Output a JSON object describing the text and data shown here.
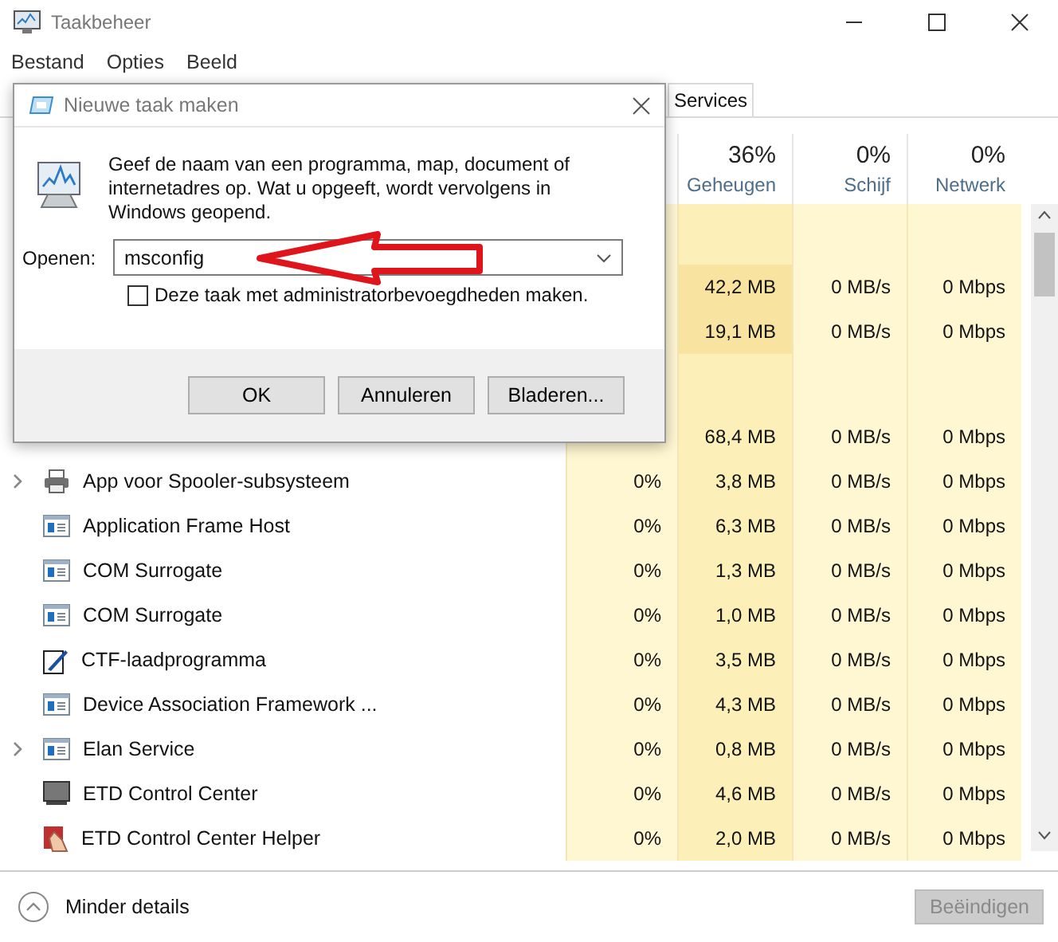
{
  "window": {
    "title": "Taakbeheer"
  },
  "menu": [
    "Bestand",
    "Opties",
    "Beeld"
  ],
  "tabs": [
    {
      "label": "Services",
      "selected": false
    }
  ],
  "columns": [
    {
      "value": "36%",
      "label": "Geheugen"
    },
    {
      "value": "0%",
      "label": "Schijf"
    },
    {
      "value": "0%",
      "label": "Netwerk"
    }
  ],
  "sections": [
    {
      "rows": [
        {
          "memory": "42,2 MB",
          "disk": "0 MB/s",
          "network": "0 Mbps"
        },
        {
          "memory": "19,1 MB",
          "disk": "0 MB/s",
          "network": "0 Mbps"
        }
      ]
    },
    {
      "rows": [
        {
          "memory": "68,4 MB",
          "disk": "0 MB/s",
          "network": "0 Mbps"
        },
        {
          "name": "App voor Spooler-subsysteem",
          "kind": "printer",
          "expandable": true,
          "cpu": "0%",
          "memory": "3,8 MB",
          "disk": "0 MB/s",
          "network": "0 Mbps"
        },
        {
          "name": "Application Frame Host",
          "kind": "app",
          "expandable": false,
          "cpu": "0%",
          "memory": "6,3 MB",
          "disk": "0 MB/s",
          "network": "0 Mbps"
        },
        {
          "name": "COM Surrogate",
          "kind": "app",
          "expandable": false,
          "cpu": "0%",
          "memory": "1,3 MB",
          "disk": "0 MB/s",
          "network": "0 Mbps"
        },
        {
          "name": "COM Surrogate",
          "kind": "app",
          "expandable": false,
          "cpu": "0%",
          "memory": "1,0 MB",
          "disk": "0 MB/s",
          "network": "0 Mbps"
        },
        {
          "name": "CTF-laadprogramma",
          "kind": "editor",
          "expandable": false,
          "cpu": "0%",
          "memory": "3,5 MB",
          "disk": "0 MB/s",
          "network": "0 Mbps"
        },
        {
          "name": "Device Association Framework ...",
          "kind": "app",
          "expandable": false,
          "cpu": "0%",
          "memory": "4,3 MB",
          "disk": "0 MB/s",
          "network": "0 Mbps"
        },
        {
          "name": "Elan Service",
          "kind": "app",
          "expandable": true,
          "cpu": "0%",
          "memory": "0,8 MB",
          "disk": "0 MB/s",
          "network": "0 Mbps"
        },
        {
          "name": "ETD Control Center",
          "kind": "monitor",
          "expandable": false,
          "cpu": "0%",
          "memory": "4,6 MB",
          "disk": "0 MB/s",
          "network": "0 Mbps"
        },
        {
          "name": "ETD Control Center Helper",
          "kind": "helper",
          "expandable": false,
          "cpu": "0%",
          "memory": "2,0 MB",
          "disk": "0 MB/s",
          "network": "0 Mbps"
        }
      ]
    }
  ],
  "footer": {
    "toggle": "Minder details",
    "end_task": {
      "label": "Beëindigen",
      "disabled": true
    }
  },
  "dialog": {
    "title": "Nieuwe taak maken",
    "message": "Geef de naam van een programma, map, document of internetadres op. Wat u opgeeft, wordt vervolgens in Windows geopend.",
    "open_label": "Openen:",
    "open_value": "msconfig",
    "admin_checkbox": {
      "label": "Deze taak met administratorbevoegdheden maken.",
      "checked": false
    },
    "buttons": [
      "OK",
      "Annuleren",
      "Bladeren..."
    ]
  }
}
